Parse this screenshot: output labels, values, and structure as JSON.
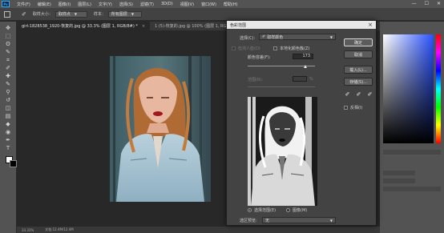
{
  "menubar": {
    "logo": "Ps",
    "items": [
      "文件(F)",
      "编辑(E)",
      "图像(I)",
      "图层(L)",
      "文字(Y)",
      "选择(S)",
      "滤镜(T)",
      "3D(D)",
      "视图(V)",
      "窗口(W)",
      "帮助(H)"
    ],
    "minimize": "—",
    "maximize": "☐",
    "close": "✕"
  },
  "options": {
    "sample_size_label": "取样大小：",
    "sample_size_value": "取样点",
    "sample_label": "样本：",
    "sample_value": "所有图层"
  },
  "tabs": [
    {
      "label": "girl-1828538_1920-恢复的.jpg @ 33.3% (图层 1, RGB/8#) *",
      "close": "×"
    },
    {
      "label": "1 (5)-恢复的.jpg @ 100% (图层 1, RGB/8#) *",
      "close": "×"
    }
  ],
  "toolbar": {
    "icons": [
      "move-icon",
      "marquee-icon",
      "lasso-icon",
      "quick-select-icon",
      "crop-icon",
      "eyedropper-icon",
      "healing-icon",
      "brush-icon",
      "stamp-icon",
      "history-brush-icon",
      "eraser-icon",
      "gradient-icon",
      "blur-icon",
      "dodge-icon",
      "pen-icon",
      "type-icon",
      "path-select-icon",
      "shape-icon",
      "hand-icon",
      "zoom-icon"
    ],
    "glyphs": [
      "✥",
      "⬚",
      "ʘ",
      "✎",
      "⌗",
      "✐",
      "✚",
      "✎",
      "⚲",
      "↺",
      "◫",
      "▤",
      "◆",
      "◉",
      "✒",
      "T",
      "▸",
      "▭",
      "✋",
      "⚲"
    ]
  },
  "status": {
    "zoom": "33.33%",
    "doc": "文档:12.4M/12.4M"
  },
  "dialog": {
    "title": "色彩范围",
    "select_label": "选择(C):",
    "select_value": "取样颜色",
    "detect_faces_label": "检测人脸(D)",
    "localized_label": "本地化颜色簇(Z)",
    "fuzziness_label": "颜色容差(F):",
    "fuzziness_value": "173",
    "fuzziness_fraction": 0.86,
    "range_label": "范围(R):",
    "range_unit": "%",
    "selection_radio_label": "选择范围(E)",
    "image_radio_label": "图像(M)",
    "preview_label": "选区预览:",
    "preview_value": "无",
    "ok_button": "确定",
    "cancel_button": "取消",
    "load_button": "载入(L)...",
    "save_button": "存储(S)...",
    "invert_label": "反相(I)"
  }
}
